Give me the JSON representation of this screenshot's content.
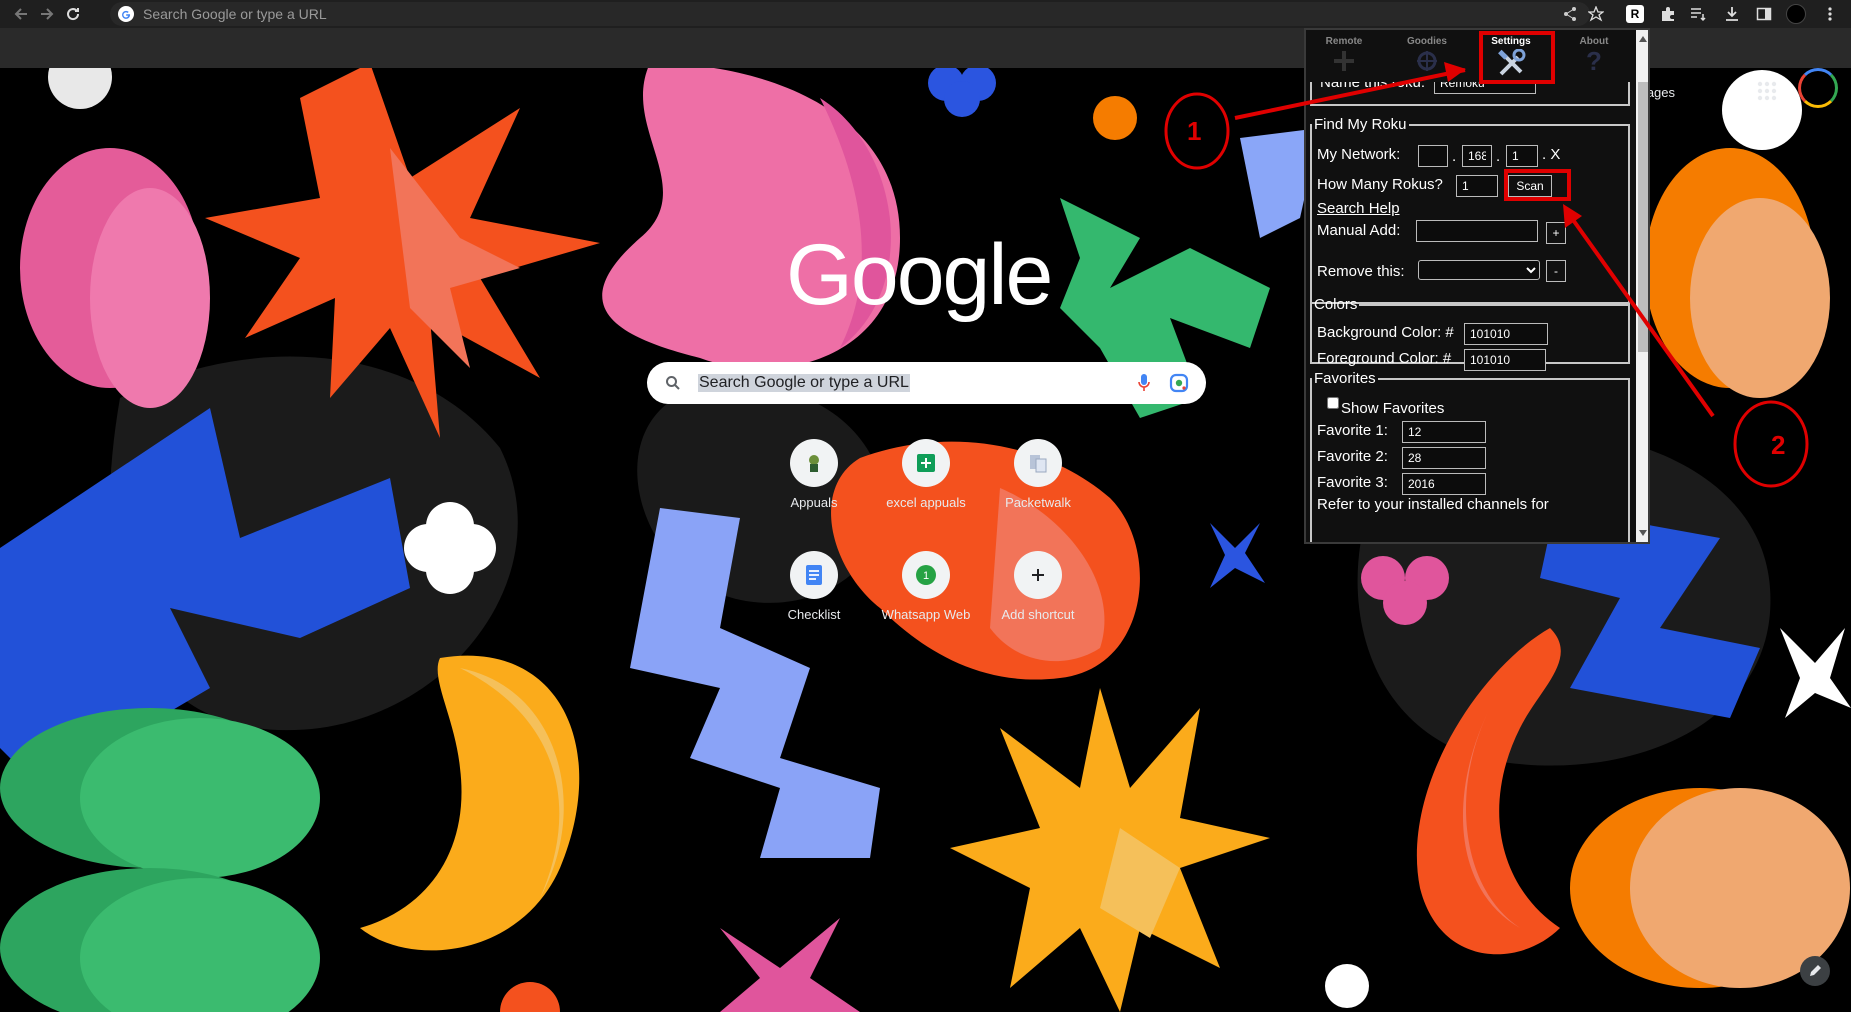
{
  "browser": {
    "omnibox_placeholder": "Search Google or type a URL",
    "extension_badge": "R"
  },
  "ntp": {
    "logo_text": "Google",
    "search_placeholder": "Search Google or type a URL",
    "images_link": "mages",
    "shortcuts": [
      {
        "label": "Appuals",
        "icon": "appuals-icon"
      },
      {
        "label": "excel appuals",
        "icon": "sheets-icon"
      },
      {
        "label": "Packetwalk",
        "icon": "packetwalk-icon"
      },
      {
        "label": "Checklist",
        "icon": "docs-icon"
      },
      {
        "label": "Whatsapp Web",
        "icon": "whatsapp-icon"
      },
      {
        "label": "Add shortcut",
        "icon": "plus-icon"
      }
    ]
  },
  "popup": {
    "tabs": [
      {
        "label": "Remote",
        "icon": "remote-dpad-icon"
      },
      {
        "label": "Goodies",
        "icon": "goodies-icon"
      },
      {
        "label": "Settings",
        "icon": "tools-icon"
      },
      {
        "label": "About",
        "icon": "question-icon"
      }
    ],
    "name_label": "Name this roku:",
    "name_value": "Remoku",
    "find": {
      "legend": "Find My Roku",
      "network_label": "My Network:",
      "ip": [
        "",
        "168",
        "1"
      ],
      "ip_dot": ".",
      "ip_last": ". X",
      "how_many_label": "How Many Rokus?",
      "how_many_value": "1",
      "scan_label": "Scan",
      "search_help": "Search Help",
      "manual_label": "Manual Add:",
      "manual_value": "",
      "plus": "+",
      "remove_label": "Remove this:",
      "minus": "-"
    },
    "colors": {
      "legend": "Colors",
      "bg_label": "Background Color: #",
      "bg_value": "101010",
      "fg_label": "Foreground Color: #",
      "fg_value": "101010"
    },
    "favorites": {
      "legend": "Favorites",
      "show_label": "Show Favorites",
      "show_checked": false,
      "fav1_label": "Favorite 1:",
      "fav1_value": "12",
      "fav2_label": "Favorite 2:",
      "fav2_value": "28",
      "fav3_label": "Favorite 3:",
      "fav3_value": "2016",
      "note": "Refer to your installed channels for"
    }
  },
  "annotations": {
    "step1": "1",
    "step2": "2",
    "color": "#e00000"
  }
}
